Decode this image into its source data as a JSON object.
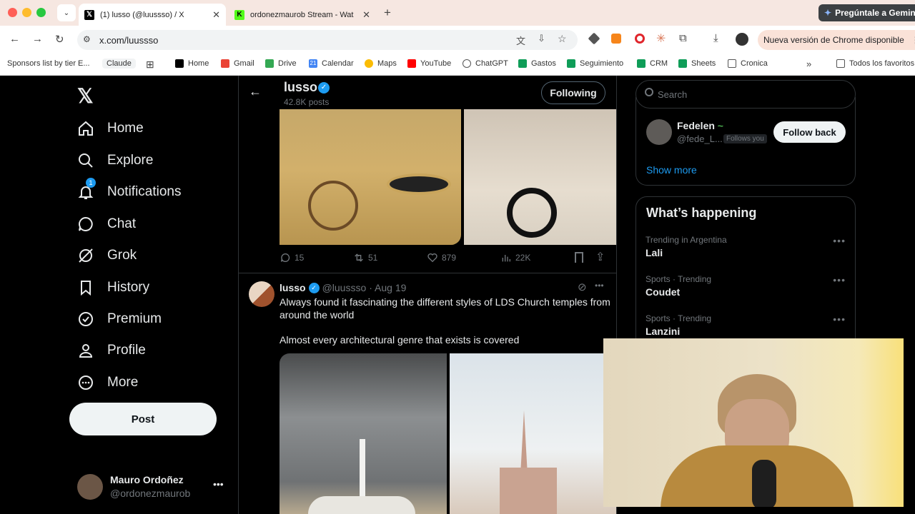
{
  "browser": {
    "tabs": [
      {
        "title": "(1) lusso (@luussso) / X",
        "active": true
      },
      {
        "title": "ordonezmaurob Stream - Wat",
        "active": false
      }
    ],
    "gemini_label": "Pregúntale a Gemini",
    "url": "x.com/luussso",
    "update_label": "Nueva versión de Chrome disponible",
    "bookmarks": [
      "Sponsors list by tier E...",
      "Claude",
      "Home",
      "Gmail",
      "Drive",
      "Calendar",
      "Maps",
      "YouTube",
      "ChatGPT",
      "Gastos",
      "Seguimiento",
      "CRM",
      "Sheets",
      "Cronica"
    ],
    "bookmarks_other": "Todos los favoritos",
    "calendar_num": "21"
  },
  "nav": {
    "items": [
      "Home",
      "Explore",
      "Notifications",
      "Chat",
      "Grok",
      "History",
      "Premium",
      "Profile",
      "More"
    ],
    "notification_count": "1",
    "post_button": "Post",
    "account": {
      "name": "Mauro Ordoñez",
      "handle": "@ordonezmaurob"
    }
  },
  "profile_header": {
    "name": "lusso",
    "posts": "42.8K posts",
    "follow_button": "Following"
  },
  "post1_actions": {
    "replies": "15",
    "reposts": "51",
    "likes": "879",
    "views": "22K"
  },
  "post2": {
    "name": "lusso",
    "handle": "@luussso",
    "date": "· Aug 19",
    "text1": "Always found it fascinating the different styles of LDS Church temples from around the world",
    "text2": "Almost every architectural genre that exists is covered"
  },
  "sidebar": {
    "search_placeholder": "Search",
    "follow": {
      "name": "Fedelen",
      "handle": "@fede_L...",
      "follows_you": "Follows you",
      "button": "Follow back"
    },
    "show_more": "Show more",
    "happening_title": "What’s happening",
    "trends": [
      {
        "context": "Trending in Argentina",
        "name": "Lali"
      },
      {
        "context": "Sports · Trending",
        "name": "Coudet"
      },
      {
        "context": "Sports · Trending",
        "name": "Lanzini"
      }
    ]
  },
  "colors": {
    "accent": "#1d9bf0",
    "background": "#000000",
    "text": "#e7e9ea",
    "muted": "#71767b"
  }
}
